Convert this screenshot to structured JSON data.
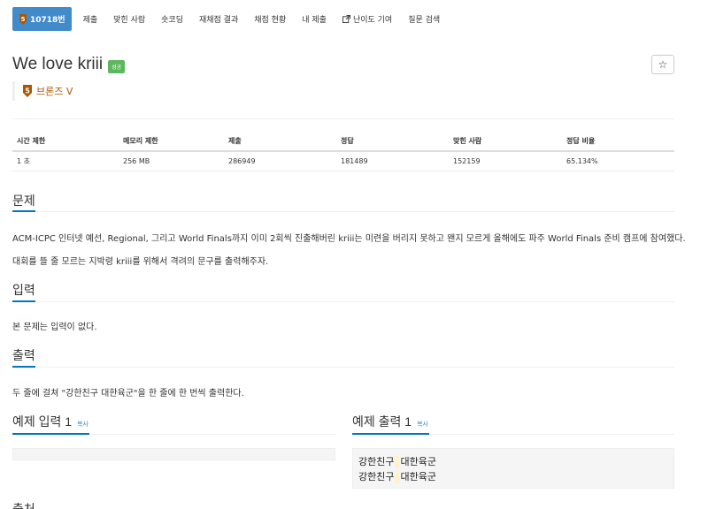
{
  "tabs": [
    {
      "label": "10718번",
      "active": true,
      "tier_number": "5"
    },
    {
      "label": "제출"
    },
    {
      "label": "맞힌 사람"
    },
    {
      "label": "숏코딩"
    },
    {
      "label": "재채점 결과"
    },
    {
      "label": "채점 현황"
    },
    {
      "label": "내 제출"
    },
    {
      "label": "난이도 기여",
      "icon": "external-link-icon"
    },
    {
      "label": "질문 검색"
    }
  ],
  "problem": {
    "title": "We love kriii",
    "status_label": "성공",
    "star_icon": "☆",
    "tier_number": "5",
    "tier_label": "브론즈 V",
    "tier_color": "#ad5600"
  },
  "info_table": {
    "headers": [
      "시간 제한",
      "메모리 제한",
      "제출",
      "정답",
      "맞힌 사람",
      "정답 비율"
    ],
    "values": [
      "1 초",
      "256 MB",
      "286949",
      "181489",
      "152159",
      "65.134%"
    ]
  },
  "sections": {
    "problem": {
      "title": "문제",
      "lines": [
        "ACM-ICPC 인터넷 예선, Regional, 그리고 World Finals까지 이미 2회씩 진출해버린 kriii는 미련을 버리지 못하고 왠지 모르게 올해에도 파주 World Finals 준비 캠프에 참여했다.",
        "대회를 뜰 줄 모르는 지박령 kriii를 위해서 격려의 문구를 출력해주자."
      ]
    },
    "input": {
      "title": "입력",
      "text": "본 문제는 입력이 없다."
    },
    "output": {
      "title": "출력",
      "text": "두 줄에 걸쳐 \"강한친구 대한육군\"을 한 줄에 한 번씩 출력한다."
    },
    "sample_input": {
      "title": "예제 입력 1",
      "copy": "복사",
      "content": ""
    },
    "sample_output": {
      "title": "예제 출력 1",
      "copy": "복사",
      "line1_a": "강한친구",
      "line1_b": "대한육군",
      "line2_a": "강한친구",
      "line2_b": "대한육군"
    },
    "next_title": "출처"
  },
  "colors": {
    "accent": "#428bca",
    "success": "#5cb85c",
    "section_underline": "#0076c0"
  }
}
